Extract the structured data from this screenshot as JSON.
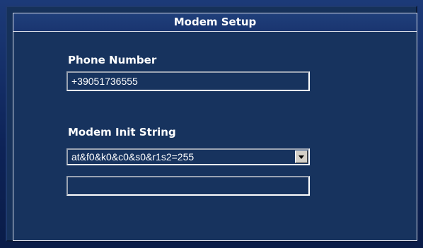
{
  "window": {
    "title": "Modem Setup"
  },
  "phone": {
    "label": "Phone Number",
    "value": "+39051736555"
  },
  "init_string": {
    "label": "Modem Init String",
    "selected": "at&f0&k0&c0&s0&r1s2=255",
    "extra_value": ""
  },
  "icons": {
    "dropdown_arrow": "chevron-down-icon"
  }
}
